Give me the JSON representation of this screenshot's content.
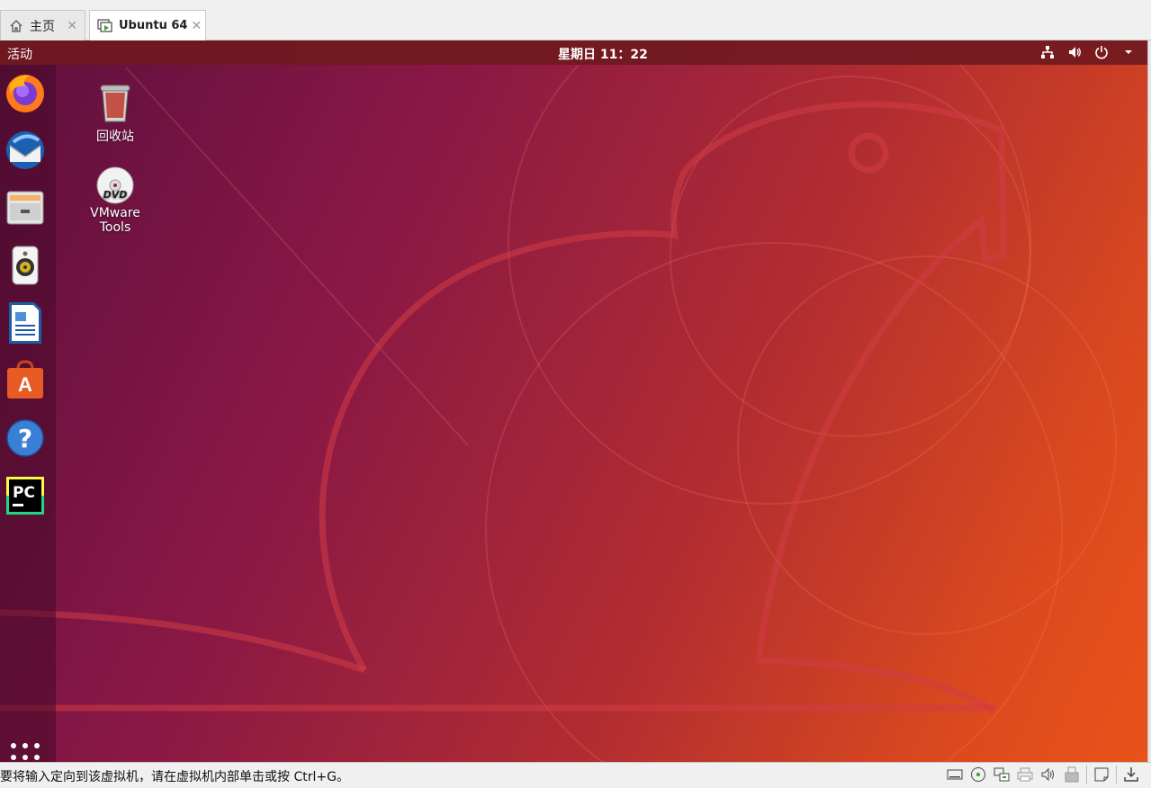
{
  "vmware": {
    "tabs": [
      {
        "label": "主页",
        "icon": "home-icon",
        "closable": true,
        "active": false
      },
      {
        "label": "Ubuntu 64",
        "icon": "vm-icon",
        "closable": true,
        "active": true
      }
    ],
    "close_glyph": "✕",
    "status_message": "要将输入定向到该虚拟机，请在虚拟机内部单击或按 Ctrl+G。",
    "device_icons": [
      "hard-disk-icon",
      "cd-dvd-icon",
      "network-adapter-icon",
      "printer-icon",
      "sound-card-icon",
      "usb-icon",
      "message-log-icon",
      "download-icon"
    ]
  },
  "gnome": {
    "activities_label": "活动",
    "clock": "星期日 11：22",
    "system_icons": [
      "network-wired-icon",
      "volume-icon",
      "power-icon",
      "dropdown-arrow-icon"
    ]
  },
  "dock": {
    "items": [
      "firefox-icon",
      "thunderbird-icon",
      "files-icon",
      "rhythmbox-icon",
      "libreoffice-writer-icon",
      "ubuntu-software-icon",
      "help-icon",
      "pycharm-icon"
    ],
    "apps_grid_icon": "show-applications-icon"
  },
  "desktop": {
    "icons": [
      {
        "label": "回收站",
        "icon": "trash-icon"
      },
      {
        "label_line1": "VMware",
        "label_line2": "Tools",
        "icon": "dvd-icon"
      }
    ]
  },
  "colors": {
    "topbar": "#70191e",
    "accent_orange": "#e9531a",
    "wallpaper_purple": "#5e0f3e"
  }
}
